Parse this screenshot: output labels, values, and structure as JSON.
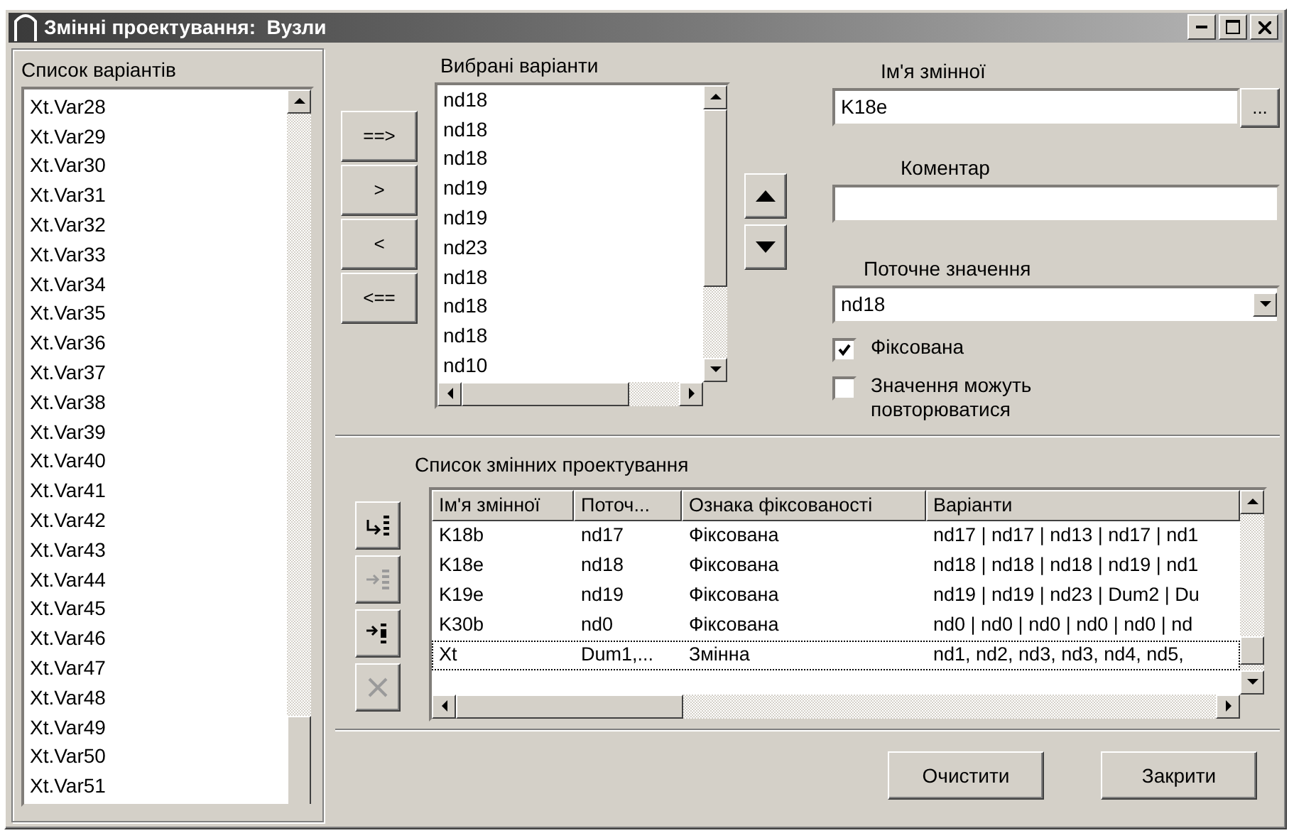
{
  "window": {
    "title": "Змінні проектування:  Вузли"
  },
  "variants_list": {
    "label": "Список варіантів",
    "items": [
      "Xt.Var28",
      "Xt.Var29",
      "Xt.Var30",
      "Xt.Var31",
      "Xt.Var32",
      "Xt.Var33",
      "Xt.Var34",
      "Xt.Var35",
      "Xt.Var36",
      "Xt.Var37",
      "Xt.Var38",
      "Xt.Var39",
      "Xt.Var40",
      "Xt.Var41",
      "Xt.Var42",
      "Xt.Var43",
      "Xt.Var44",
      "Xt.Var45",
      "Xt.Var46",
      "Xt.Var47",
      "Xt.Var48",
      "Xt.Var49",
      "Xt.Var50",
      "Xt.Var51"
    ]
  },
  "transfer_buttons": [
    "==>",
    ">",
    "<",
    "<=="
  ],
  "selected_variants": {
    "label": "Вибрані варіанти",
    "items": [
      "nd18",
      "nd18",
      "nd18",
      "nd19",
      "nd19",
      "nd23",
      "nd18",
      "nd18",
      "nd18",
      "nd10"
    ]
  },
  "variable_name": {
    "label": "Ім'я змінної",
    "value": "K18e",
    "browse_button": "..."
  },
  "comment": {
    "label": "Коментар"
  },
  "current_value": {
    "label": "Поточне значення",
    "value": "nd18"
  },
  "checkboxes": [
    {
      "label": "Фіксована",
      "checked": true
    },
    {
      "label": "Значення можуть повторюватися",
      "checked": false
    }
  ],
  "variables_table": {
    "label": "Список змінних проектування",
    "tool_buttons": [
      {
        "kind": "insert",
        "disabled": false
      },
      {
        "kind": "replace",
        "disabled": true
      },
      {
        "kind": "append",
        "disabled": false
      },
      {
        "kind": "delete",
        "disabled": true
      }
    ],
    "columns": [
      "Ім'я змінної",
      "Поточ...",
      "Ознака фіксованості",
      "Варіанти"
    ],
    "rows": [
      {
        "cells": [
          "K18b",
          "nd17",
          "Фіксована",
          "nd17 | nd17 | nd13 | nd17 | nd1"
        ],
        "selected": false
      },
      {
        "cells": [
          "K18e",
          "nd18",
          "Фіксована",
          "nd18 | nd18 | nd18 | nd19 | nd1"
        ],
        "selected": false
      },
      {
        "cells": [
          "K19e",
          "nd19",
          "Фіксована",
          "nd19 | nd19 | nd23 | Dum2 | Du"
        ],
        "selected": false
      },
      {
        "cells": [
          "K30b",
          "nd0",
          "Фіксована",
          "nd0 | nd0 | nd0 | nd0 | nd0 | nd"
        ],
        "selected": false
      },
      {
        "cells": [
          "Xt",
          "Dum1,...",
          "Змінна",
          "nd1, nd2, nd3, nd3, nd4, nd5,"
        ],
        "selected": true
      }
    ]
  },
  "buttons": [
    "Очистити",
    "Закрити"
  ]
}
